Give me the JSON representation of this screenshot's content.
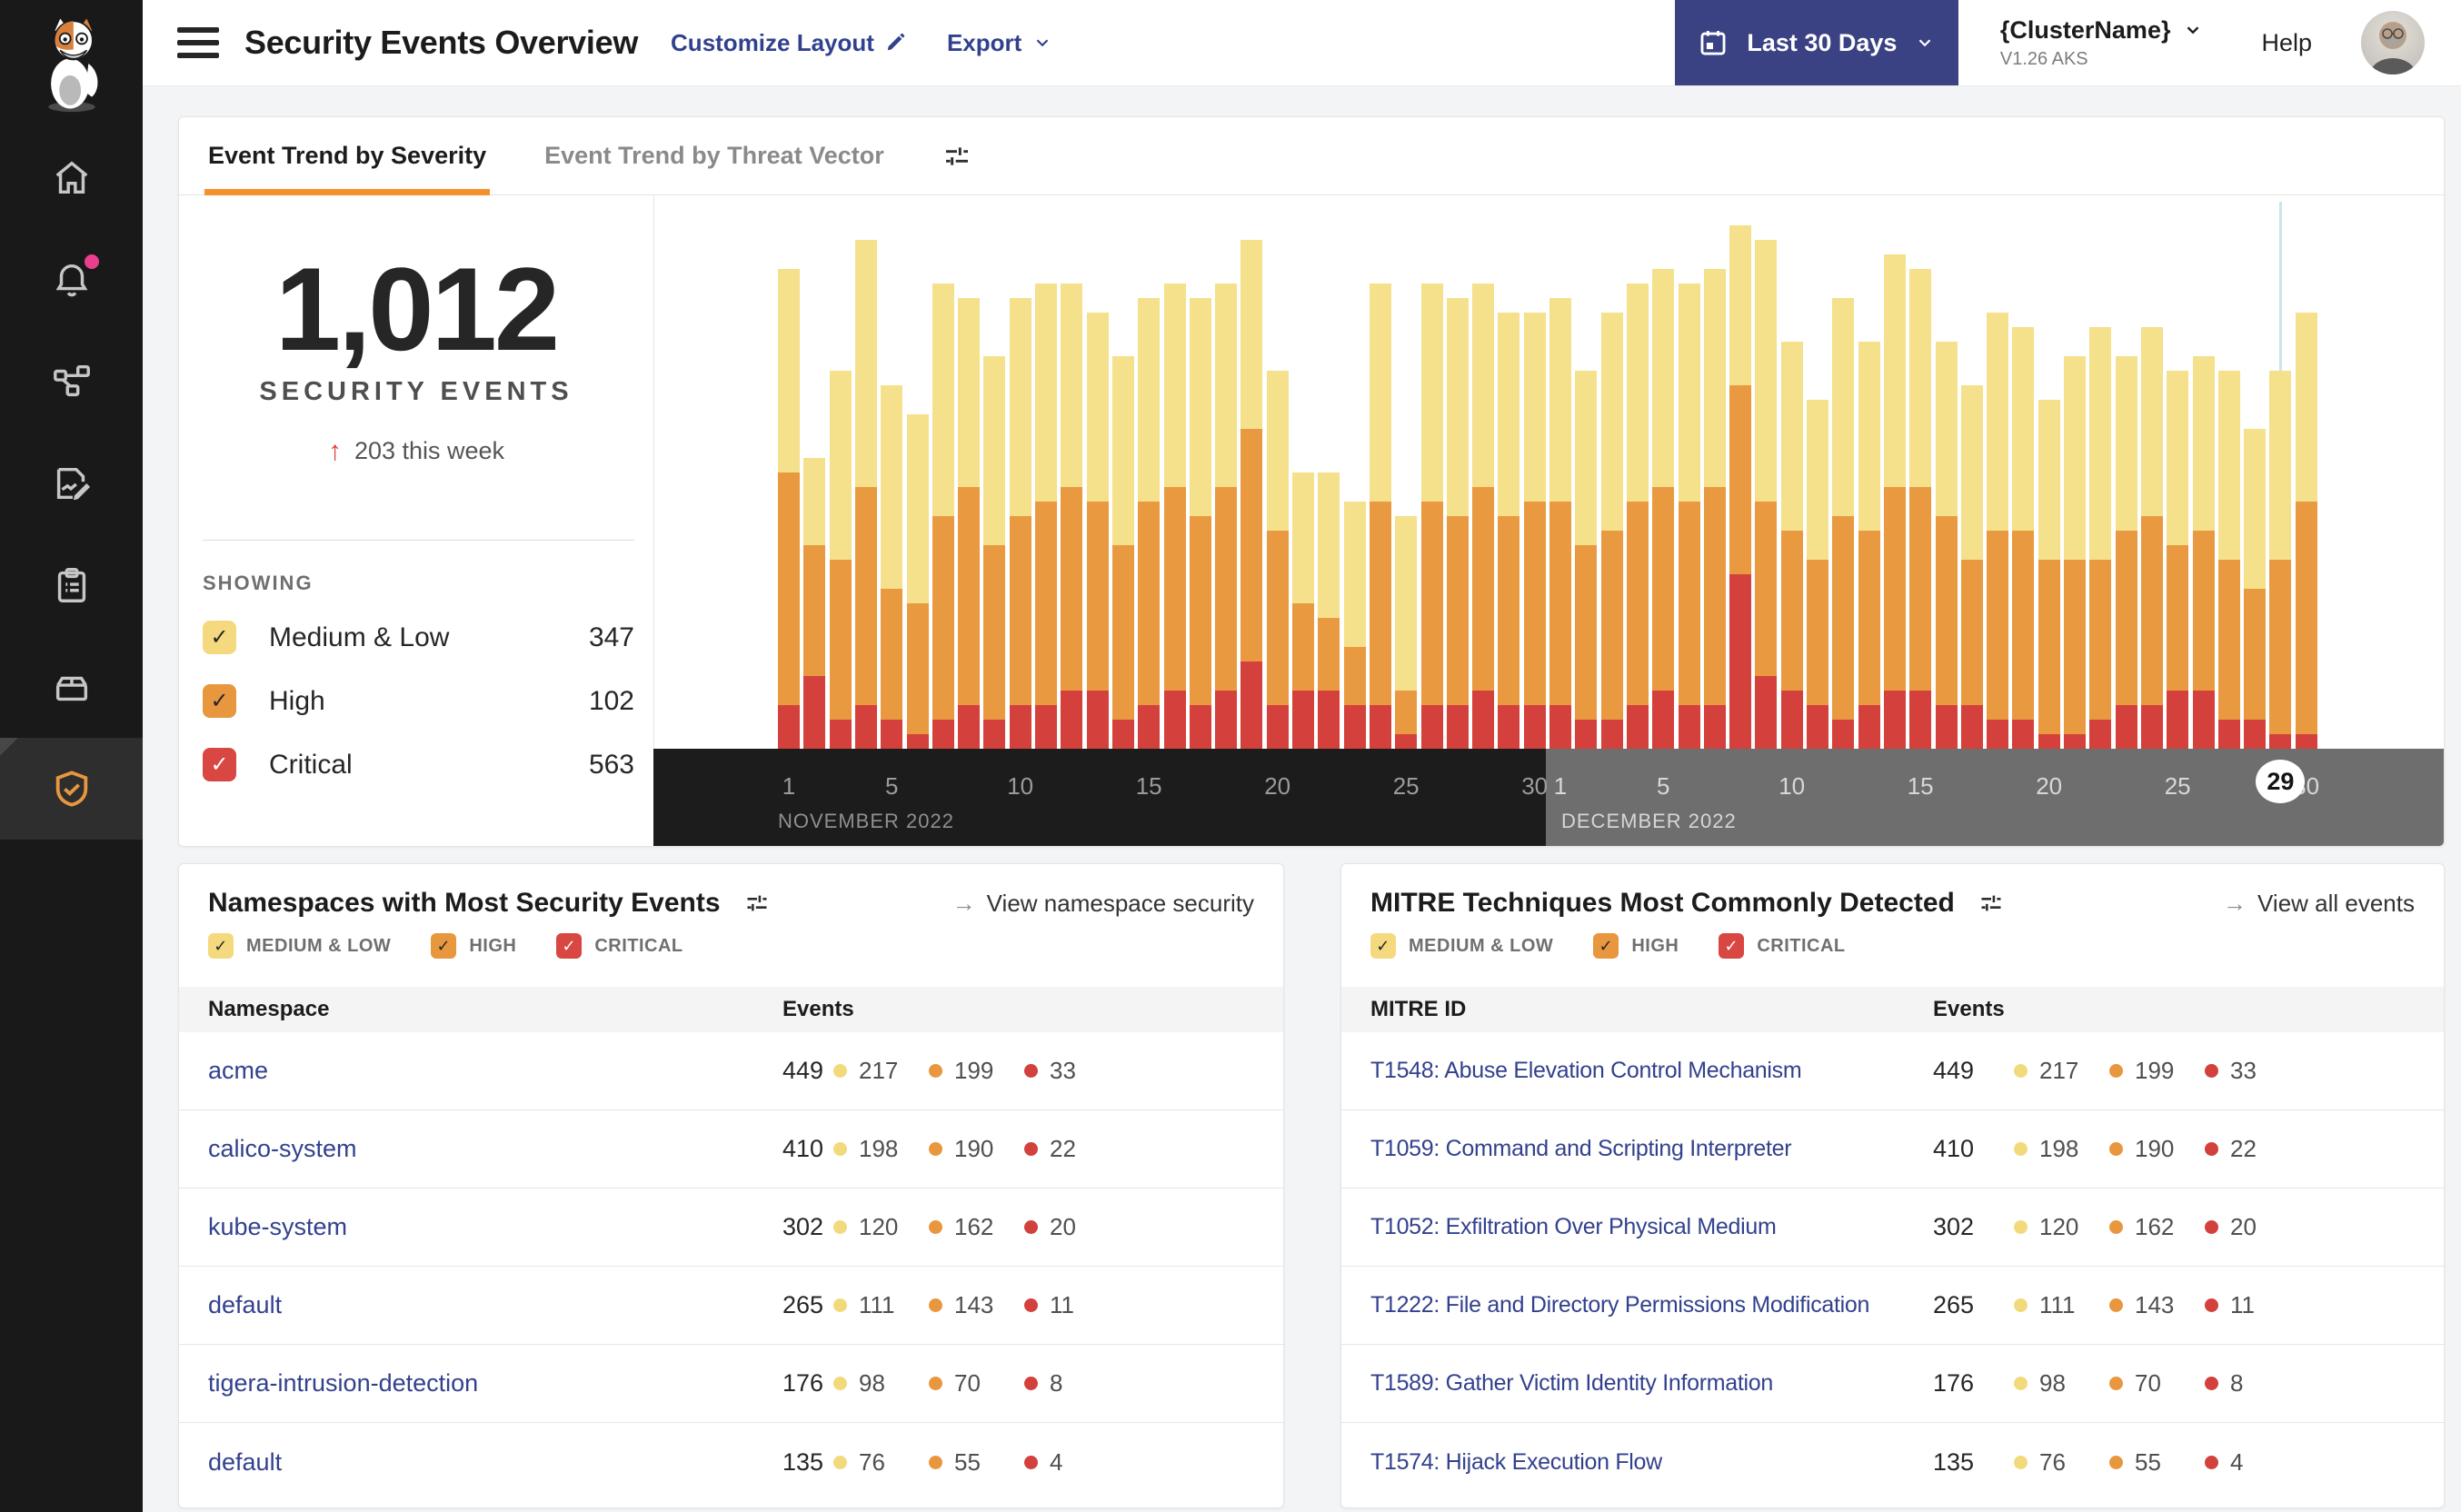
{
  "header": {
    "title": "Security Events Overview",
    "customize_label": "Customize Layout",
    "export_label": "Export",
    "date_range": "Last 30 Days",
    "cluster_name": "{ClusterName}",
    "cluster_version": "V1.26 AKS",
    "help_label": "Help"
  },
  "colors": {
    "medium_low": "#F5E08C",
    "high": "#E99A40",
    "critical": "#D4403B",
    "accent_orange": "#F2912D",
    "link_blue": "#32418D",
    "button_navy": "#3A4284",
    "badge_pink": "#EC3E8E"
  },
  "sidebar": {
    "items": [
      {
        "icon": "calico-cat-logo",
        "active": false
      },
      {
        "icon": "home-icon",
        "active": false
      },
      {
        "icon": "bell-icon",
        "active": false,
        "badge": true
      },
      {
        "icon": "service-graph-icon",
        "active": false
      },
      {
        "icon": "policy-edit-icon",
        "active": false
      },
      {
        "icon": "clipboard-icon",
        "active": false
      },
      {
        "icon": "workloads-icon",
        "active": false
      },
      {
        "icon": "shield-check-icon",
        "active": true
      }
    ]
  },
  "trend_card": {
    "tabs": [
      {
        "label": "Event Trend by Severity",
        "active": true
      },
      {
        "label": "Event Trend by Threat Vector",
        "active": false
      }
    ],
    "summary": {
      "total": "1,012",
      "subtitle": "SECURITY EVENTS",
      "delta_arrow": "↑",
      "delta": "203 this week",
      "showing_label": "SHOWING"
    },
    "legend": [
      {
        "label": "Medium & Low",
        "count": 347,
        "color": "#F5D97E"
      },
      {
        "label": "High",
        "count": 102,
        "color": "#E8973F"
      },
      {
        "label": "Critical",
        "count": 563,
        "color": "#D84741"
      }
    ]
  },
  "chart_data": {
    "type": "bar",
    "stacked": true,
    "series_names": [
      "Critical",
      "High",
      "Medium & Low"
    ],
    "colors": {
      "critical": "#D4403B",
      "high": "#E99A40",
      "medium_low": "#F5E08C"
    },
    "ylim": [
      0,
      36
    ],
    "grid": false,
    "months": [
      {
        "label": "NOVEMBER 2022",
        "ticks": [
          1,
          5,
          10,
          15,
          20,
          25,
          30
        ]
      },
      {
        "label": "DECEMBER 2022",
        "ticks": [
          1,
          5,
          10,
          15,
          20,
          25,
          30
        ]
      }
    ],
    "highlighted_day": {
      "month": "DECEMBER 2022",
      "day": 29
    },
    "days": [
      {
        "day": "Nov 1",
        "critical": 3,
        "high": 16,
        "medium_low": 14
      },
      {
        "day": "Nov 2",
        "critical": 5,
        "high": 9,
        "medium_low": 6
      },
      {
        "day": "Nov 3",
        "critical": 2,
        "high": 11,
        "medium_low": 13
      },
      {
        "day": "Nov 4",
        "critical": 3,
        "high": 15,
        "medium_low": 17
      },
      {
        "day": "Nov 5",
        "critical": 2,
        "high": 9,
        "medium_low": 14
      },
      {
        "day": "Nov 6",
        "critical": 1,
        "high": 9,
        "medium_low": 13
      },
      {
        "day": "Nov 7",
        "critical": 2,
        "high": 14,
        "medium_low": 16
      },
      {
        "day": "Nov 8",
        "critical": 3,
        "high": 15,
        "medium_low": 13
      },
      {
        "day": "Nov 9",
        "critical": 2,
        "high": 12,
        "medium_low": 13
      },
      {
        "day": "Nov 10",
        "critical": 3,
        "high": 13,
        "medium_low": 15
      },
      {
        "day": "Nov 11",
        "critical": 3,
        "high": 14,
        "medium_low": 15
      },
      {
        "day": "Nov 12",
        "critical": 4,
        "high": 14,
        "medium_low": 14
      },
      {
        "day": "Nov 13",
        "critical": 4,
        "high": 13,
        "medium_low": 13
      },
      {
        "day": "Nov 14",
        "critical": 2,
        "high": 12,
        "medium_low": 13
      },
      {
        "day": "Nov 15",
        "critical": 3,
        "high": 14,
        "medium_low": 14
      },
      {
        "day": "Nov 16",
        "critical": 4,
        "high": 14,
        "medium_low": 14
      },
      {
        "day": "Nov 17",
        "critical": 3,
        "high": 13,
        "medium_low": 15
      },
      {
        "day": "Nov 18",
        "critical": 4,
        "high": 14,
        "medium_low": 14
      },
      {
        "day": "Nov 19",
        "critical": 6,
        "high": 16,
        "medium_low": 13
      },
      {
        "day": "Nov 20",
        "critical": 3,
        "high": 12,
        "medium_low": 11
      },
      {
        "day": "Nov 21",
        "critical": 4,
        "high": 6,
        "medium_low": 9
      },
      {
        "day": "Nov 22",
        "critical": 4,
        "high": 5,
        "medium_low": 10
      },
      {
        "day": "Nov 23",
        "critical": 3,
        "high": 4,
        "medium_low": 10
      },
      {
        "day": "Nov 24",
        "critical": 3,
        "high": 14,
        "medium_low": 15
      },
      {
        "day": "Nov 25",
        "critical": 1,
        "high": 3,
        "medium_low": 12
      },
      {
        "day": "Nov 26",
        "critical": 3,
        "high": 14,
        "medium_low": 15
      },
      {
        "day": "Nov 27",
        "critical": 3,
        "high": 13,
        "medium_low": 15
      },
      {
        "day": "Nov 28",
        "critical": 4,
        "high": 14,
        "medium_low": 14
      },
      {
        "day": "Nov 29",
        "critical": 3,
        "high": 13,
        "medium_low": 14
      },
      {
        "day": "Nov 30",
        "critical": 3,
        "high": 14,
        "medium_low": 13
      },
      {
        "day": "Dec 1",
        "critical": 3,
        "high": 14,
        "medium_low": 14
      },
      {
        "day": "Dec 2",
        "critical": 2,
        "high": 12,
        "medium_low": 12
      },
      {
        "day": "Dec 3",
        "critical": 2,
        "high": 13,
        "medium_low": 15
      },
      {
        "day": "Dec 4",
        "critical": 3,
        "high": 14,
        "medium_low": 15
      },
      {
        "day": "Dec 5",
        "critical": 4,
        "high": 14,
        "medium_low": 15
      },
      {
        "day": "Dec 6",
        "critical": 3,
        "high": 14,
        "medium_low": 15
      },
      {
        "day": "Dec 7",
        "critical": 3,
        "high": 15,
        "medium_low": 15
      },
      {
        "day": "Dec 8",
        "critical": 12,
        "high": 13,
        "medium_low": 11
      },
      {
        "day": "Dec 9",
        "critical": 5,
        "high": 12,
        "medium_low": 18
      },
      {
        "day": "Dec 10",
        "critical": 4,
        "high": 11,
        "medium_low": 13
      },
      {
        "day": "Dec 11",
        "critical": 3,
        "high": 10,
        "medium_low": 11
      },
      {
        "day": "Dec 12",
        "critical": 2,
        "high": 14,
        "medium_low": 15
      },
      {
        "day": "Dec 13",
        "critical": 3,
        "high": 12,
        "medium_low": 13
      },
      {
        "day": "Dec 14",
        "critical": 4,
        "high": 14,
        "medium_low": 16
      },
      {
        "day": "Dec 15",
        "critical": 4,
        "high": 14,
        "medium_low": 15
      },
      {
        "day": "Dec 16",
        "critical": 3,
        "high": 13,
        "medium_low": 12
      },
      {
        "day": "Dec 17",
        "critical": 3,
        "high": 10,
        "medium_low": 12
      },
      {
        "day": "Dec 18",
        "critical": 2,
        "high": 13,
        "medium_low": 15
      },
      {
        "day": "Dec 19",
        "critical": 2,
        "high": 13,
        "medium_low": 14
      },
      {
        "day": "Dec 20",
        "critical": 1,
        "high": 12,
        "medium_low": 11
      },
      {
        "day": "Dec 21",
        "critical": 1,
        "high": 12,
        "medium_low": 14
      },
      {
        "day": "Dec 22",
        "critical": 2,
        "high": 11,
        "medium_low": 16
      },
      {
        "day": "Dec 23",
        "critical": 3,
        "high": 12,
        "medium_low": 12
      },
      {
        "day": "Dec 24",
        "critical": 3,
        "high": 13,
        "medium_low": 13
      },
      {
        "day": "Dec 25",
        "critical": 4,
        "high": 10,
        "medium_low": 12
      },
      {
        "day": "Dec 26",
        "critical": 4,
        "high": 11,
        "medium_low": 12
      },
      {
        "day": "Dec 27",
        "critical": 2,
        "high": 11,
        "medium_low": 13
      },
      {
        "day": "Dec 28",
        "critical": 2,
        "high": 9,
        "medium_low": 11
      },
      {
        "day": "Dec 29",
        "critical": 1,
        "high": 12,
        "medium_low": 13
      },
      {
        "day": "Dec 30",
        "critical": 1,
        "high": 16,
        "medium_low": 13
      }
    ]
  },
  "namespaces_card": {
    "title": "Namespaces with Most Security Events",
    "link_arrow": "→",
    "link_label": "View namespace security",
    "filters": [
      {
        "label": "MEDIUM & LOW",
        "checked": true,
        "color": "#F5D97E"
      },
      {
        "label": "HIGH",
        "checked": true,
        "color": "#E8973F"
      },
      {
        "label": "CRITICAL",
        "checked": true,
        "color": "#D84741"
      }
    ],
    "columns": [
      "Namespace",
      "Events"
    ],
    "rows": [
      {
        "name": "acme",
        "total": 449,
        "medium_low": 217,
        "high": 199,
        "critical": 33
      },
      {
        "name": "calico-system",
        "total": 410,
        "medium_low": 198,
        "high": 190,
        "critical": 22
      },
      {
        "name": "kube-system",
        "total": 302,
        "medium_low": 120,
        "high": 162,
        "critical": 20
      },
      {
        "name": "default",
        "total": 265,
        "medium_low": 111,
        "high": 143,
        "critical": 11
      },
      {
        "name": "tigera-intrusion-detection",
        "total": 176,
        "medium_low": 98,
        "high": 70,
        "critical": 8
      },
      {
        "name": "default",
        "total": 135,
        "medium_low": 76,
        "high": 55,
        "critical": 4
      }
    ]
  },
  "mitre_card": {
    "title": "MITRE Techniques Most Commonly Detected",
    "link_arrow": "→",
    "link_label": "View all events",
    "filters": [
      {
        "label": "MEDIUM & LOW",
        "checked": true,
        "color": "#F5D97E"
      },
      {
        "label": "HIGH",
        "checked": true,
        "color": "#E8973F"
      },
      {
        "label": "CRITICAL",
        "checked": true,
        "color": "#D84741"
      }
    ],
    "columns": [
      "MITRE ID",
      "Events"
    ],
    "rows": [
      {
        "name": "T1548: Abuse Elevation Control Mechanism",
        "total": 449,
        "medium_low": 217,
        "high": 199,
        "critical": 33
      },
      {
        "name": "T1059: Command and Scripting Interpreter",
        "total": 410,
        "medium_low": 198,
        "high": 190,
        "critical": 22
      },
      {
        "name": "T1052: Exfiltration Over Physical Medium",
        "total": 302,
        "medium_low": 120,
        "high": 162,
        "critical": 20
      },
      {
        "name": "T1222: File and Directory Permissions Modification",
        "total": 265,
        "medium_low": 111,
        "high": 143,
        "critical": 11
      },
      {
        "name": "T1589: Gather Victim Identity Information",
        "total": 176,
        "medium_low": 98,
        "high": 70,
        "critical": 8
      },
      {
        "name": "T1574: Hijack Execution Flow",
        "total": 135,
        "medium_low": 76,
        "high": 55,
        "critical": 4
      }
    ]
  }
}
